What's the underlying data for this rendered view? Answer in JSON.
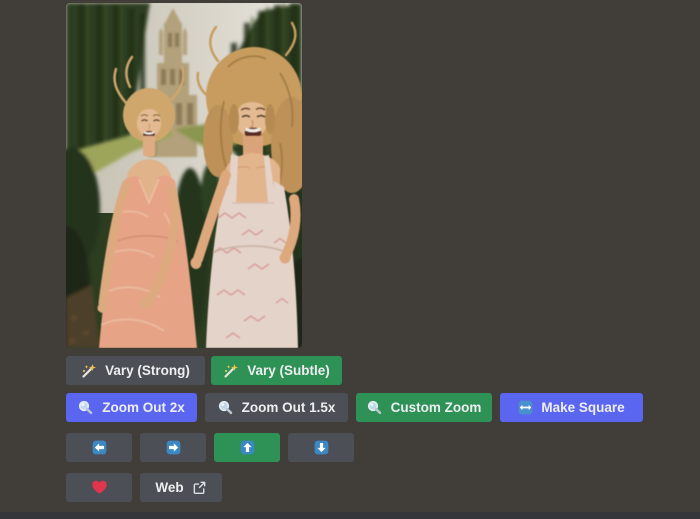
{
  "colors": {
    "page_bg": "#413e39",
    "button_secondary_bg": "#4c4f56",
    "button_primary_bg": "#5b66f0",
    "button_success_bg": "#2e9155",
    "button_text": "#eceef0",
    "emoji_arrow_blue": "#3b88c3",
    "heart_red": "#e0354d",
    "message_input_bg": "#34363c"
  },
  "attachment": {
    "description": "AI-generated photo: two laughing young women in pink summer dresses running toward the camera along a formal garden alley of tall clipped hedges, with a gothic cathedral tower in the hazy background"
  },
  "icons": {
    "vary": "magic-wand-icon",
    "zoom": "magnifying-glass-icon",
    "make_square": "left-right-arrow-icon",
    "pan": [
      "arrow-left-icon",
      "arrow-right-icon",
      "arrow-up-icon",
      "arrow-down-icon"
    ],
    "favorite": "heart-icon",
    "web": "external-link-icon"
  },
  "buttons": {
    "vary_strong": {
      "label": "Vary (Strong)"
    },
    "vary_subtle": {
      "label": "Vary (Subtle)"
    },
    "zoom_out_2x": {
      "label": "Zoom Out 2x"
    },
    "zoom_out_1_5x": {
      "label": "Zoom Out 1.5x"
    },
    "custom_zoom": {
      "label": "Custom Zoom"
    },
    "make_square": {
      "label": "Make Square"
    },
    "web": {
      "label": "Web"
    }
  }
}
